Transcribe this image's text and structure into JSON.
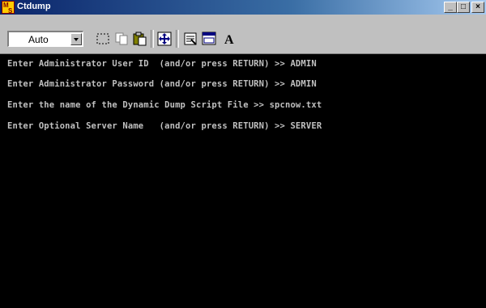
{
  "window": {
    "title": "Ctdump",
    "icon": "ms-app-icon"
  },
  "window_controls": {
    "minimize": "_",
    "maximize": "□",
    "close": "×"
  },
  "toolbar": {
    "font_size_value": "Auto",
    "font_label": "A",
    "buttons": [
      "mark",
      "copy",
      "paste",
      "fullscreen",
      "properties",
      "background",
      "font"
    ]
  },
  "console": {
    "background": "#000000",
    "text_color": "#c0c0c0",
    "lines": [
      "Enter Administrator User ID  (and/or press RETURN) >> ADMIN",
      "Enter Administrator Password (and/or press RETURN) >> ADMIN",
      "Enter the name of the Dynamic Dump Script File >> spcnow.txt",
      "Enter Optional Server Name   (and/or press RETURN) >> SERVER"
    ]
  }
}
